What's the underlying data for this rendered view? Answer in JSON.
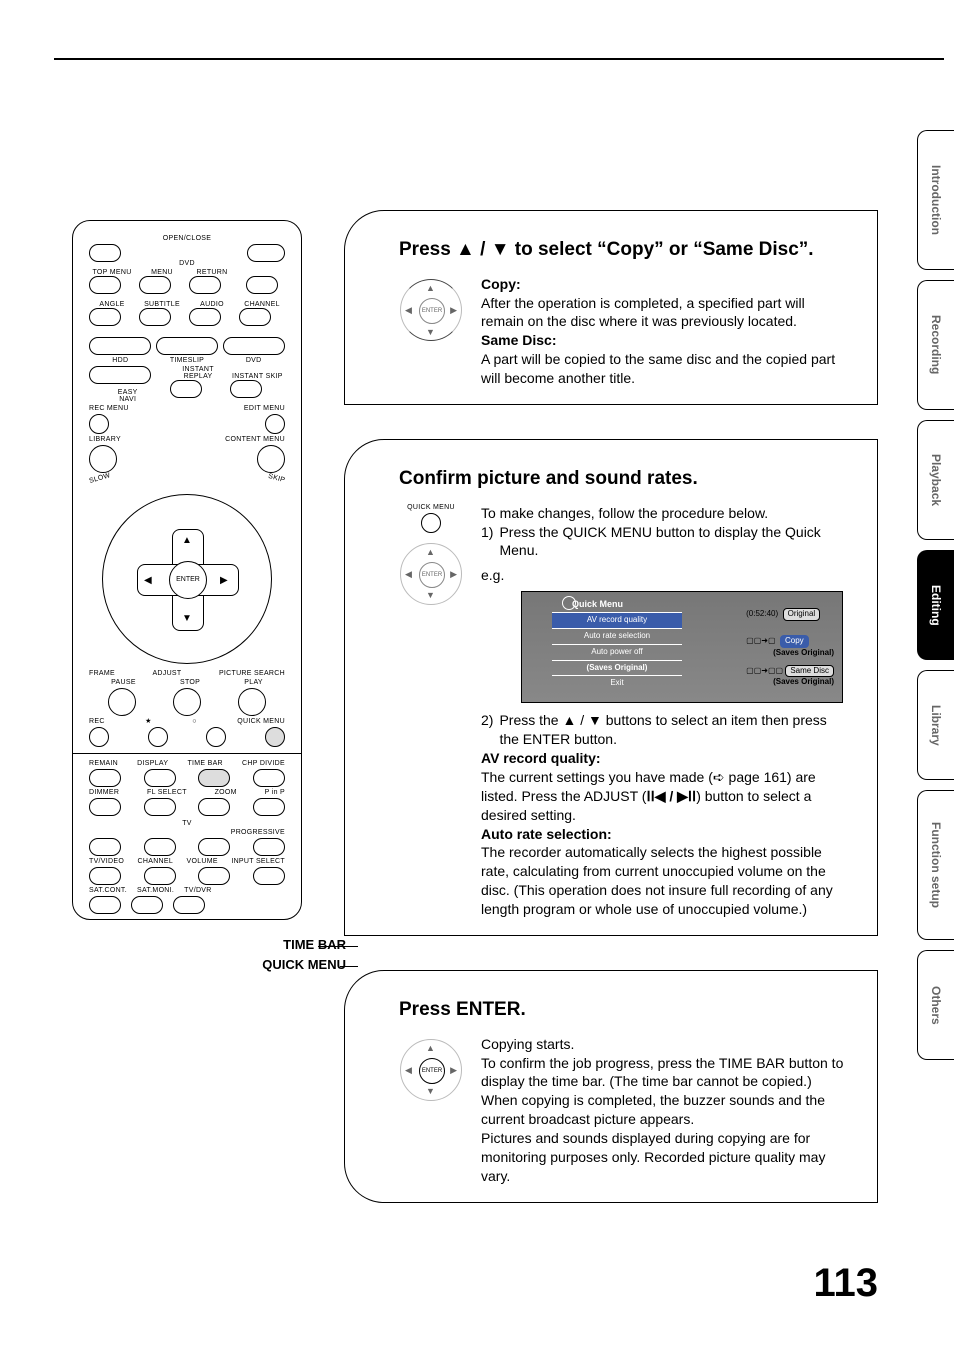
{
  "page_number": "113",
  "side_tabs": [
    "Introduction",
    "Recording",
    "Playback",
    "Editing",
    "Library",
    "Function setup",
    "Others"
  ],
  "captions": {
    "time_bar": "TIME BAR",
    "quick_menu": "QUICK MENU"
  },
  "remote": {
    "open_close": "OPEN/CLOSE",
    "dvd": "DVD",
    "top_menu": "TOP MENU",
    "menu": "MENU",
    "return": "RETURN",
    "angle": "ANGLE",
    "subtitle": "SUBTITLE",
    "audio": "AUDIO",
    "channel": "CHANNEL",
    "hdd": "HDD",
    "timeslip": "TIMESLIP",
    "dvd2": "DVD",
    "easy_navi": "EASY\nNAVI",
    "instant_replay": "INSTANT REPLAY",
    "instant_skip": "INSTANT SKIP",
    "rec_menu": "REC MENU",
    "edit_menu": "EDIT MENU",
    "library": "LIBRARY",
    "content_menu": "CONTENT MENU",
    "slow": "SLOW",
    "skip": "SKIP",
    "enter": "ENTER",
    "frame": "FRAME",
    "adjust": "ADJUST",
    "picture_search": "PICTURE SEARCH",
    "pause": "PAUSE",
    "stop": "STOP",
    "play": "PLAY",
    "rec": "REC",
    "quick_menu_btn": "QUICK MENU",
    "remain": "REMAIN",
    "display": "DISPLAY",
    "time_bar": "TIME BAR",
    "chp_divide": "CHP DIVIDE",
    "dimmer": "DIMMER",
    "fl_select": "FL SELECT",
    "zoom": "ZOOM",
    "pinp": "P in P",
    "tv": "TV",
    "progressive": "PROGRESSIVE",
    "tv_video": "TV/VIDEO",
    "channel2": "CHANNEL",
    "volume": "VOLUME",
    "input_select": "INPUT SELECT",
    "sat_cont": "SAT.CONT.",
    "sat_moni": "SAT.MONI.",
    "tv_dvr": "TV/DVR"
  },
  "step5": {
    "title": "Press ▲ / ▼ to select “Copy” or “Same Disc”.",
    "copy_label": "Copy:",
    "copy_text": "After the operation is completed, a specified part will remain on the disc where it was previously located.",
    "same_label": "Same Disc:",
    "same_text": "A part will be copied to the same disc and the copied part will become another title."
  },
  "step6": {
    "title": "Confirm picture and sound rates.",
    "quick_menu_label": "QUICK MENU",
    "intro": "To make changes, follow the procedure below.",
    "sub1": "Press the QUICK MENU button to display the Quick Menu.",
    "eg": "e.g.",
    "qm": {
      "header": "Quick Menu",
      "items": [
        "AV record quality",
        "Auto rate selection",
        "Auto power off",
        "Exit"
      ],
      "saves": "(Saves Original)",
      "time": "(0:52:40)",
      "original": "Original",
      "copy": "Copy",
      "same_disc": "Same Disc",
      "saves2": "(Saves Original)"
    },
    "sub2_a": "Press the ▲ / ▼ buttons to select an item then press the ENTER button.",
    "av_label": "AV record quality:",
    "av_text_a": "The current settings you have made (",
    "av_page": " page 161) are listed. Press the ADJUST (",
    "av_text_b": ") button to select a desired setting.",
    "auto_label": "Auto rate selection:",
    "auto_text": "The recorder automatically selects the highest possible rate, calculating from current unoccupied volume on the disc. (This operation does not insure full recording of any length program or whole use of unoccupied volume.)"
  },
  "step7": {
    "title": "Press ENTER.",
    "p1": "Copying starts.",
    "p2": "To confirm the job progress, press the TIME BAR button to display the time bar. (The time bar cannot be copied.) When copying is completed, the buzzer sounds and the current broadcast picture appears.",
    "p3": "Pictures and sounds displayed during copying are for monitoring purposes only. Recorded picture quality may vary.",
    "enter": "ENTER"
  }
}
